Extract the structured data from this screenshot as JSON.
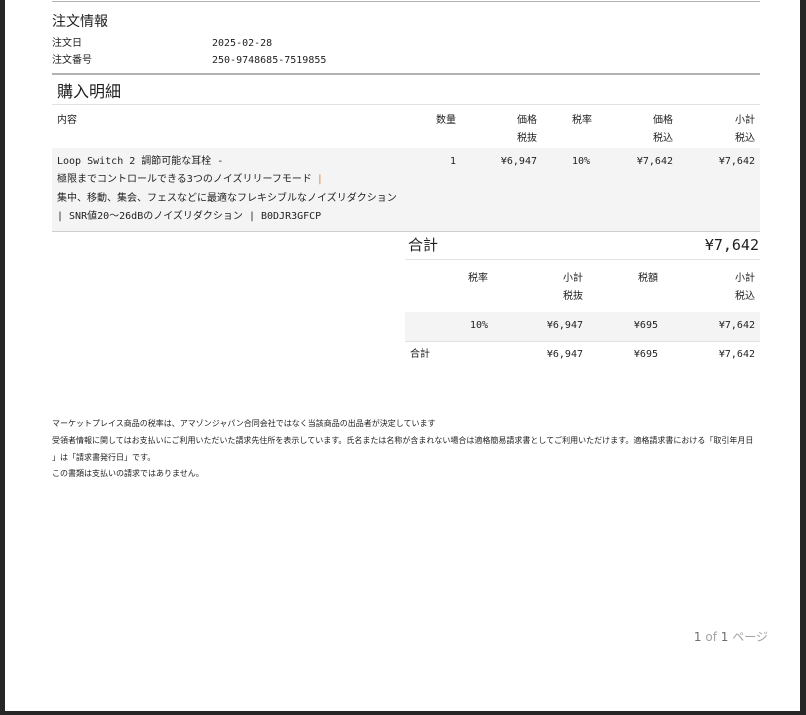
{
  "colors": {
    "viewer_bg": "#262626",
    "row_shade": "#f4f4f4",
    "separator_accent": "#e37b34"
  },
  "order_info": {
    "title": "注文情報",
    "date_label": "注文日",
    "date": "2025-02-28",
    "number_label": "注文番号",
    "number": "250-9748685-7519855"
  },
  "purchase": {
    "title": "購入明細",
    "columns": {
      "content": "内容",
      "quantity": "数量",
      "price_ex_tax": {
        "label": "価格",
        "sub": "税抜"
      },
      "tax_rate": "税率",
      "price_in_tax": {
        "label": "価格",
        "sub": "税込"
      },
      "subtotal_in_tax": {
        "label": "小計",
        "sub": "税込"
      }
    },
    "items": [
      {
        "description_lines": [
          "Loop Switch 2 調節可能な耳栓 -",
          "極限までコントロールできる3つのノイズリリーフモード",
          "集中、移動、集会、フェスなどに最適なフレキシブルなノイズリダクション",
          "| SNR値20～26dBのノイズリダクション | B0DJR3GFCP"
        ],
        "line2_separator": "|",
        "quantity": "1",
        "price_ex_tax": "¥6,947",
        "tax_rate": "10%",
        "price_in_tax": "¥7,642",
        "subtotal_in_tax": "¥7,642"
      }
    ],
    "total_label": "合計",
    "total": "¥7,642"
  },
  "tax_summary": {
    "columns": {
      "tax_rate": "税率",
      "subtotal_ex_tax": {
        "label": "小計",
        "sub": "税抜"
      },
      "tax_amount": "税額",
      "subtotal_in_tax": {
        "label": "小計",
        "sub": "税込"
      }
    },
    "rows": [
      {
        "tax_rate": "10%",
        "subtotal_ex_tax": "¥6,947",
        "tax_amount": "¥695",
        "subtotal_in_tax": "¥7,642"
      }
    ],
    "total": {
      "label": "合計",
      "subtotal_ex_tax": "¥6,947",
      "tax_amount": "¥695",
      "subtotal_in_tax": "¥7,642"
    }
  },
  "notes": [
    "マーケットプレイス商品の税率は、アマゾンジャパン合同会社ではなく当該商品の出品者が決定しています",
    "受領者情報に関してはお支払いにご利用いただいた請求先住所を表示しています。氏名または名称が含まれない場合は適格簡易請求書としてご利用いただけます。適格請求書における「取引年月日",
    "」は「請求書発行日」です。",
    "この書類は支払いの請求ではありません。"
  ],
  "pagination": {
    "current": "1",
    "of": "of",
    "total": "1",
    "unit": "ページ"
  }
}
